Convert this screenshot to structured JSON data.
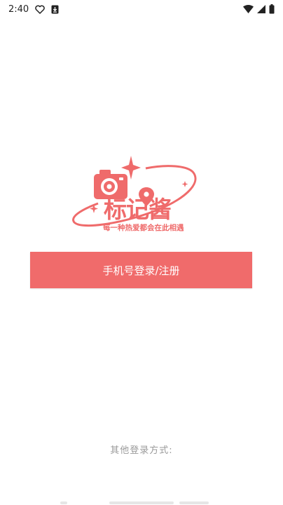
{
  "status_bar": {
    "time": "2:40",
    "icons": [
      "heart-outline-icon",
      "download-icon",
      "wifi-icon",
      "cellular-signal-icon",
      "battery-icon"
    ]
  },
  "logo": {
    "brand_name": "标记酱",
    "tagline": "每一种热爱都会在此相遇",
    "brand_color": "#ef6b6b"
  },
  "login": {
    "phone_button_label": "手机号登录/注册",
    "other_methods_label": "其他登录方式:"
  },
  "colors": {
    "accent": "#f06b6b",
    "muted_text": "#9a9a9a",
    "background": "#ffffff"
  }
}
